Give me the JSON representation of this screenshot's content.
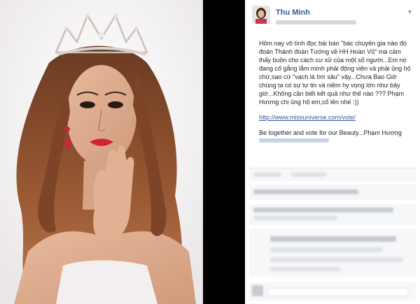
{
  "author": {
    "name": "Thu Minh"
  },
  "post": {
    "paragraph_1": "Hôm nay vô tình đọc bài báo \"bác chuyên gia nào đó đoán Thành đoàn Tướng về HH Hoàn Vũ\" mà cảm thấy buồn cho cách cư xử của một số người...Em nó đang cố gắng lắm mình phải động viên và phải ủng hộ chứ,sao cứ \"vạch lá tìm sâu\" vậy...Chưa Bao Giờ chúng ta có sự tự tin và niềm hy vọng lớn như bây giờ...Không cần biết kết quả như thế nào ??? Phạm Hương chị ủng hộ em,cố lên nhé :))",
    "link": "http://www.missuniverse.com/vote/",
    "paragraph_2": "Be together and vote for our Beauty...Phạm Hương"
  },
  "icons": {
    "options": "chevron-down-icon",
    "crown": "crown-icon"
  },
  "colors": {
    "link": "#365899",
    "author": "#365899",
    "lips": "#d4212f"
  }
}
